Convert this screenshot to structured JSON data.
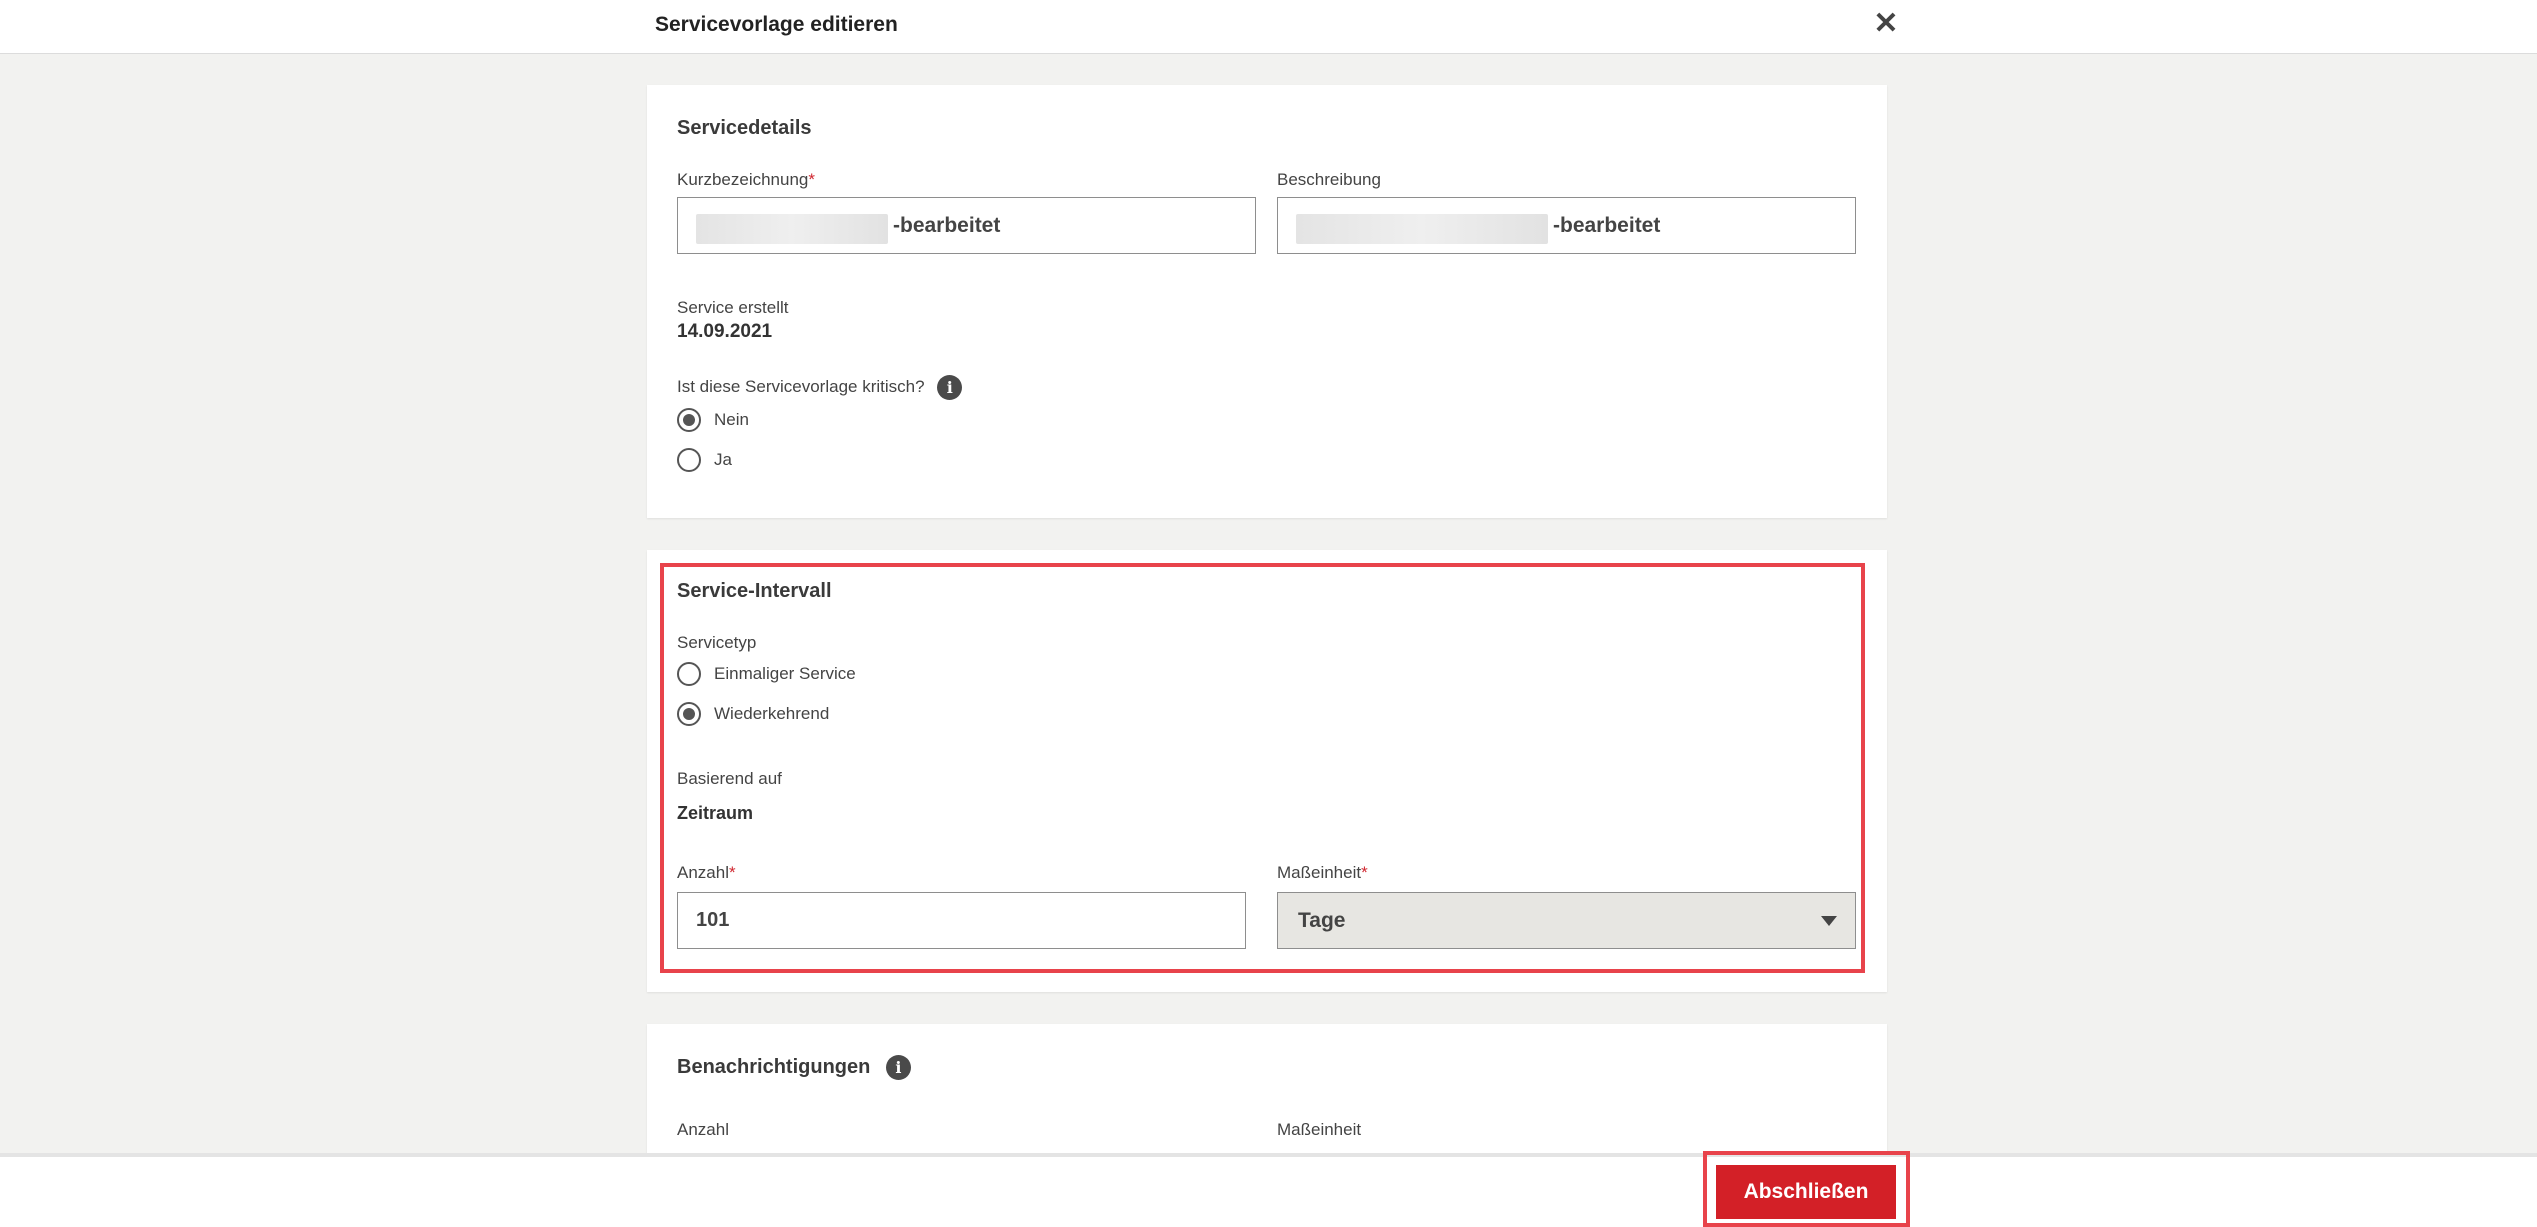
{
  "window": {
    "title": "Servicevorlage editieren",
    "close_icon": "close-icon"
  },
  "servicedetails": {
    "heading": "Servicedetails",
    "kurz_label": "Kurzbezeichnung",
    "kurz_value_suffix": "-bearbeitet",
    "beschreibung_label": "Beschreibung",
    "beschreibung_value_suffix": "-bearbeitet",
    "created_label": "Service erstellt",
    "created_value": "14.09.2021",
    "critical_question": "Ist diese Servicevorlage kritisch?",
    "critical_options": [
      {
        "label": "Nein",
        "selected": true
      },
      {
        "label": "Ja",
        "selected": false
      }
    ]
  },
  "interval": {
    "heading": "Service-Intervall",
    "type_label": "Servicetyp",
    "type_options": [
      {
        "label": "Einmaliger Service",
        "selected": false
      },
      {
        "label": "Wiederkehrend",
        "selected": true
      }
    ],
    "based_label": "Basierend auf",
    "based_value": "Zeitraum",
    "anzahl_label": "Anzahl",
    "anzahl_value": "101",
    "einheit_label": "Maßeinheit",
    "einheit_value": "Tage"
  },
  "notifications": {
    "heading": "Benachrichtigungen",
    "anzahl_label": "Anzahl",
    "einheit_label": "Maßeinheit"
  },
  "footer": {
    "submit_label": "Abschließen"
  },
  "colors": {
    "accent": "#d32027",
    "highlight": "#e8434b",
    "required": "#d0262f"
  }
}
